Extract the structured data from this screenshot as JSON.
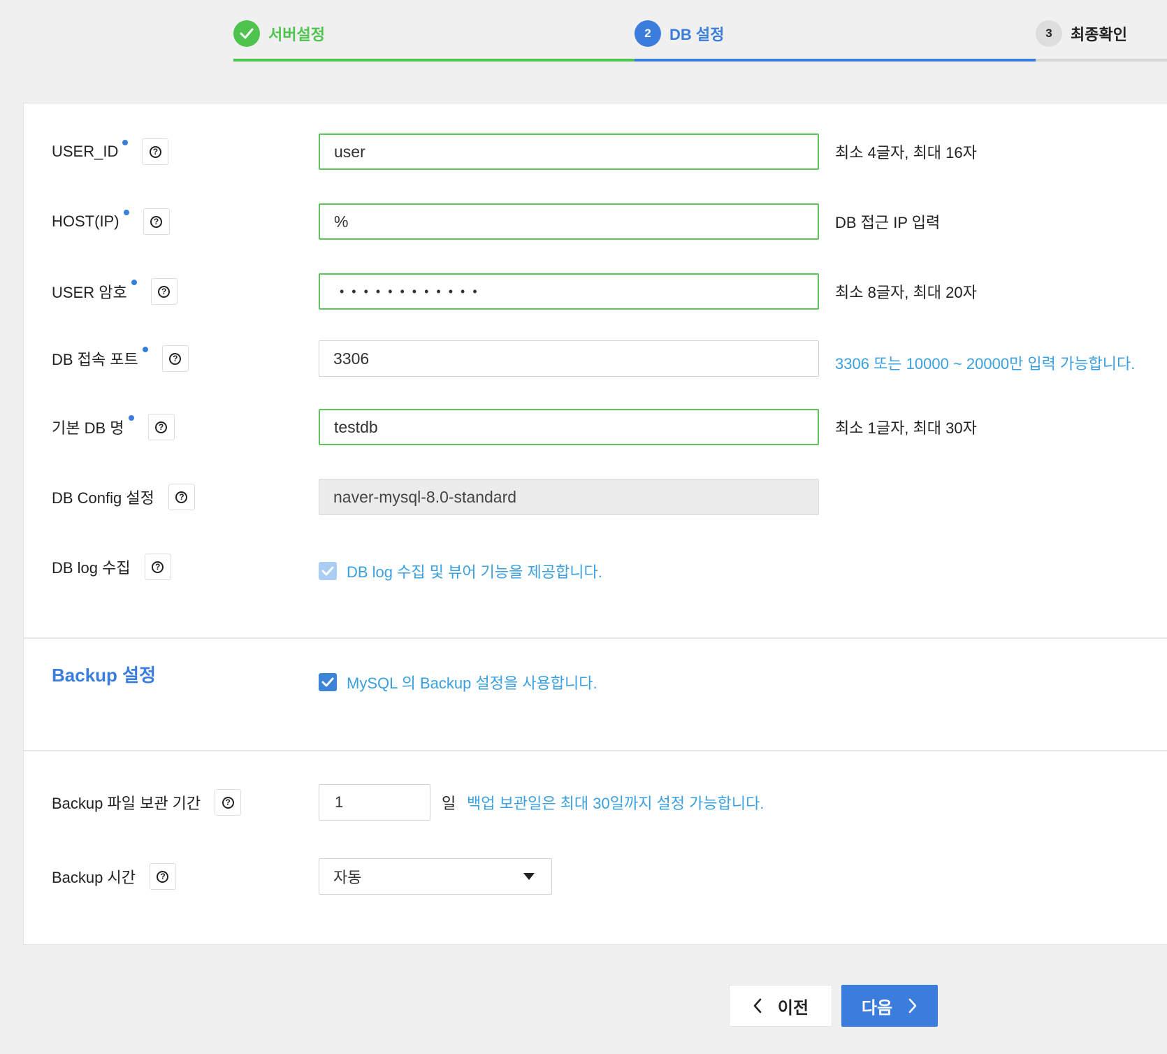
{
  "stepper": {
    "steps": [
      {
        "number": "",
        "label": "서버설정",
        "state": "done"
      },
      {
        "number": "2",
        "label": "DB 설정",
        "state": "active"
      },
      {
        "number": "3",
        "label": "최종확인",
        "state": "pending"
      }
    ]
  },
  "form": {
    "user_id": {
      "label": "USER_ID",
      "value": "user",
      "hint": "최소 4글자, 최대 16자"
    },
    "host": {
      "label": "HOST(IP)",
      "value": "%",
      "hint": "DB 접근 IP 입력"
    },
    "password": {
      "label": "USER 암호",
      "value": "••••••••••••",
      "hint": "최소 8글자, 최대 20자"
    },
    "port": {
      "label": "DB 접속 포트",
      "value": "3306",
      "hint": "3306 또는 10000 ~ 20000만 입력 가능합니다."
    },
    "db_name": {
      "label": "기본 DB 명",
      "value": "testdb",
      "hint": "최소 1글자, 최대 30자"
    },
    "db_config": {
      "label": "DB Config 설정",
      "value": "naver-mysql-8.0-standard"
    },
    "db_log": {
      "label": "DB log 수집",
      "checkbox_label": "DB log 수집 및 뷰어 기능을 제공합니다.",
      "checked": true
    }
  },
  "backup": {
    "title": "Backup 설정",
    "checkbox_label": "MySQL 의 Backup 설정을 사용합니다.",
    "checked": true,
    "retention": {
      "label": "Backup 파일 보관 기간",
      "value": "1",
      "unit": "일",
      "hint": "백업 보관일은 최대 30일까지 설정 가능합니다."
    },
    "time": {
      "label": "Backup 시간",
      "selected": "자동"
    }
  },
  "footer": {
    "prev_label": "이전",
    "next_label": "다음"
  },
  "colors": {
    "success": "#4ec34e",
    "primary": "#3b7ddd",
    "hint_blue": "#3aa0e0"
  }
}
